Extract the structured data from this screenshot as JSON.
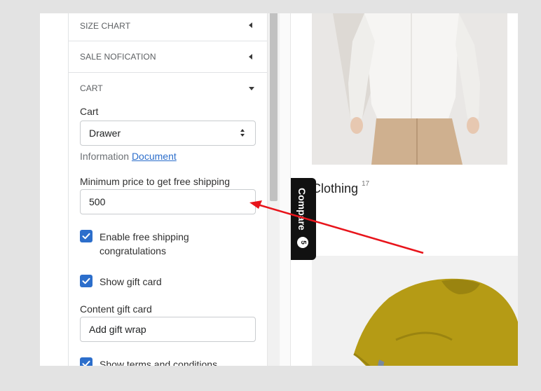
{
  "settings_panel": {
    "sections": [
      {
        "label": "SIZE CHART",
        "state": "collapsed"
      },
      {
        "label": "SALE NOFICATION",
        "state": "collapsed"
      },
      {
        "label": "CART",
        "state": "expanded"
      }
    ],
    "cart": {
      "cart_label": "Cart",
      "cart_select_value": "Drawer",
      "info_prefix": "Information",
      "info_link": "Document",
      "min_price_label": "Minimum price to get free shipping",
      "min_price_value": "500",
      "enable_free_shipping_label": "Enable free shipping congratulations",
      "enable_free_shipping_checked": true,
      "show_gift_card_label": "Show gift card",
      "show_gift_card_checked": true,
      "content_gift_card_label": "Content gift card",
      "content_gift_card_value": "Add gift wrap",
      "show_terms_label": "Show terms and conditions",
      "show_terms_checked": true
    }
  },
  "preview": {
    "category_title": "Clothing",
    "category_count": "17",
    "compare_label": "Compare",
    "compare_count": "5"
  },
  "colors": {
    "accent": "#2c6ecb",
    "annotation_arrow": "#e8141b",
    "compare_tab_bg": "#111111"
  },
  "icons": [
    "caret-left-icon",
    "caret-down-icon",
    "select-arrows-icon",
    "checkmark-icon"
  ]
}
